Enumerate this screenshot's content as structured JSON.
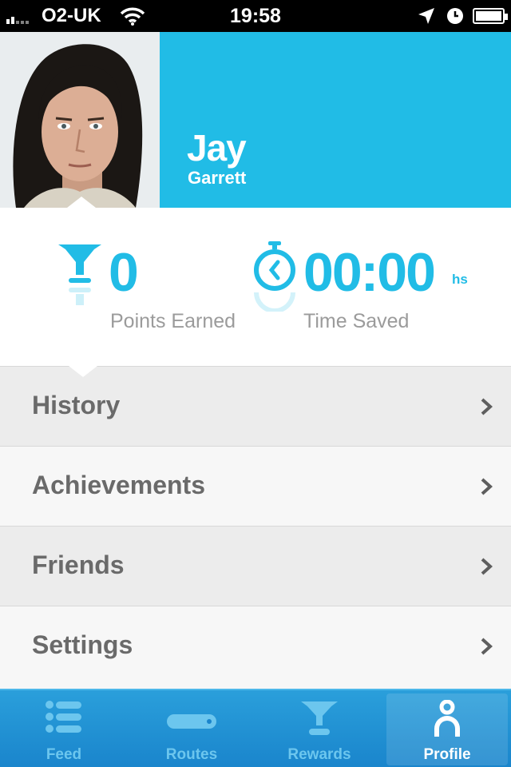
{
  "status": {
    "carrier": "O2-UK",
    "time": "19:58"
  },
  "profile": {
    "first_name": "Jay",
    "last_name": "Garrett"
  },
  "stats": {
    "points_value": "0",
    "points_label": "Points Earned",
    "time_value": "00:00",
    "time_unit": "hs",
    "time_label": "Time Saved"
  },
  "menu": {
    "items": [
      {
        "label": "History"
      },
      {
        "label": "Achievements"
      },
      {
        "label": "Friends"
      },
      {
        "label": "Settings"
      }
    ]
  },
  "tabbar": {
    "tabs": [
      {
        "label": "Feed",
        "icon": "list-icon"
      },
      {
        "label": "Routes",
        "icon": "route-icon"
      },
      {
        "label": "Rewards",
        "icon": "trophy-icon"
      },
      {
        "label": "Profile",
        "icon": "person-icon"
      }
    ],
    "active": "Profile"
  },
  "colors": {
    "accent": "#21bce6",
    "tabbar": "#1a85cc",
    "menu_text": "#6a6a6a"
  }
}
